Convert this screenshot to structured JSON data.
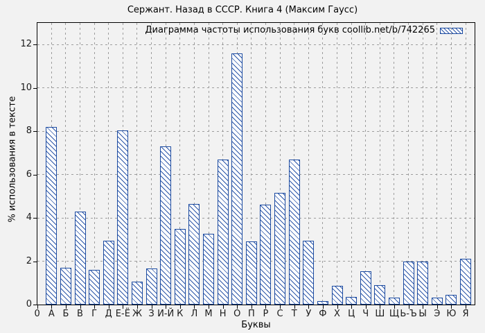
{
  "chart_data": {
    "type": "bar",
    "title": "Сержант. Назад в СССР. Книга 4 (Максим Гаусс)",
    "legend_label": "Диаграмма частоты использования букв coollib.net/b/742265",
    "xlabel": "Буквы",
    "ylabel": "% использования в тексте",
    "origin_tick_label": "0",
    "yticks": [
      0,
      2,
      4,
      6,
      8,
      10,
      12
    ],
    "ylim": [
      0,
      13
    ],
    "grid": true,
    "legend_position": "top-right-inside",
    "categories": [
      "А",
      "Б",
      "В",
      "Г",
      "Д",
      "Е-Ё",
      "Ж",
      "З",
      "И-Й",
      "К",
      "Л",
      "М",
      "Н",
      "О",
      "П",
      "Р",
      "С",
      "Т",
      "У",
      "Ф",
      "Х",
      "Ц",
      "Ч",
      "Ш",
      "Щ",
      "Ь-Ъ",
      "Ы",
      "Э",
      "Ю",
      "Я"
    ],
    "values": [
      8.2,
      1.7,
      4.3,
      1.6,
      2.95,
      8.05,
      1.05,
      1.65,
      7.3,
      3.5,
      4.65,
      3.25,
      6.7,
      11.6,
      2.9,
      4.6,
      5.15,
      6.7,
      2.95,
      0.15,
      0.85,
      0.35,
      1.55,
      0.9,
      0.32,
      2.0,
      1.98,
      0.33,
      0.45,
      2.1
    ],
    "colors": {
      "background": "#f2f2f2",
      "bar_border": "#1b4aa0",
      "bar_fill": "#ffffff",
      "hatch": "#2a55a8",
      "grid": "#9c9c9c",
      "axis": "#000000",
      "text": "#000000",
      "tick_text": "#1a1a1a"
    }
  }
}
